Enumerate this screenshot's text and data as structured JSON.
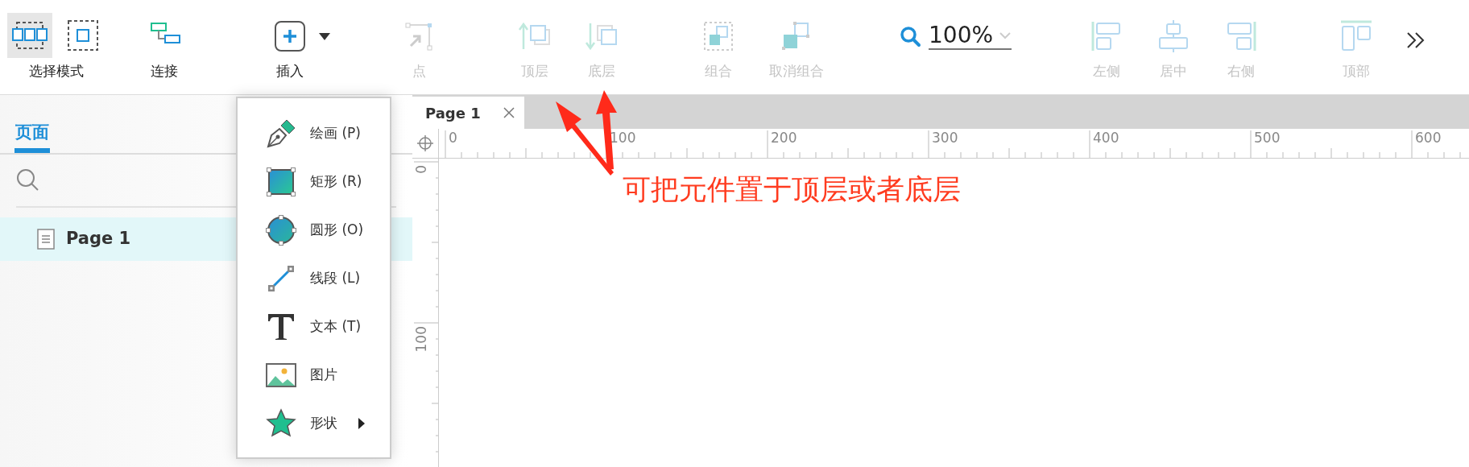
{
  "toolbar": {
    "items": [
      {
        "kind": "select_mode",
        "label": "选择模式",
        "disabled": false,
        "modes": [
          {
            "kind": "intersect",
            "selected": true
          },
          {
            "kind": "contain",
            "selected": false
          }
        ]
      },
      {
        "kind": "connect",
        "label": "连接",
        "disabled": false
      },
      {
        "kind": "insert",
        "label": "插入",
        "disabled": false
      },
      {
        "kind": "point",
        "label": "点",
        "disabled": true
      },
      {
        "kind": "front",
        "label": "顶层",
        "disabled": true
      },
      {
        "kind": "back",
        "label": "底层",
        "disabled": true
      },
      {
        "kind": "group",
        "label": "组合",
        "disabled": true
      },
      {
        "kind": "ungroup",
        "label": "取消组合",
        "disabled": true
      },
      {
        "kind": "zoom",
        "value": "100%"
      },
      {
        "kind": "align_left",
        "label": "左侧",
        "disabled": true
      },
      {
        "kind": "align_center",
        "label": "居中",
        "disabled": true
      },
      {
        "kind": "align_right",
        "label": "右侧",
        "disabled": true
      },
      {
        "kind": "align_top",
        "label": "顶部",
        "disabled": true
      },
      {
        "kind": "more"
      }
    ]
  },
  "sidebar": {
    "tabs": [
      {
        "label": "页面",
        "selected": true
      }
    ],
    "pages": [
      {
        "label": "Page 1",
        "selected": true
      }
    ]
  },
  "insert_menu": {
    "items": [
      {
        "kind": "pen",
        "label": "绘画 (P)",
        "submenu": false
      },
      {
        "kind": "rectangle",
        "label": "矩形 (R)",
        "submenu": false
      },
      {
        "kind": "ellipse",
        "label": "圆形 (O)",
        "submenu": false
      },
      {
        "kind": "line",
        "label": "线段 (L)",
        "submenu": false
      },
      {
        "kind": "text",
        "label": "文本 (T)",
        "submenu": false
      },
      {
        "kind": "image",
        "label": "图片",
        "submenu": false
      },
      {
        "kind": "star",
        "label": "形状",
        "submenu": true
      }
    ]
  },
  "document_tabs": [
    {
      "label": "Page 1",
      "selected": true
    }
  ],
  "rulers": {
    "horizontal": [
      "0",
      "100",
      "200",
      "300",
      "400",
      "500",
      "600"
    ],
    "vertical": [
      "0",
      "100"
    ]
  },
  "annotation": {
    "text": "可把元件置于顶层或者底层"
  }
}
